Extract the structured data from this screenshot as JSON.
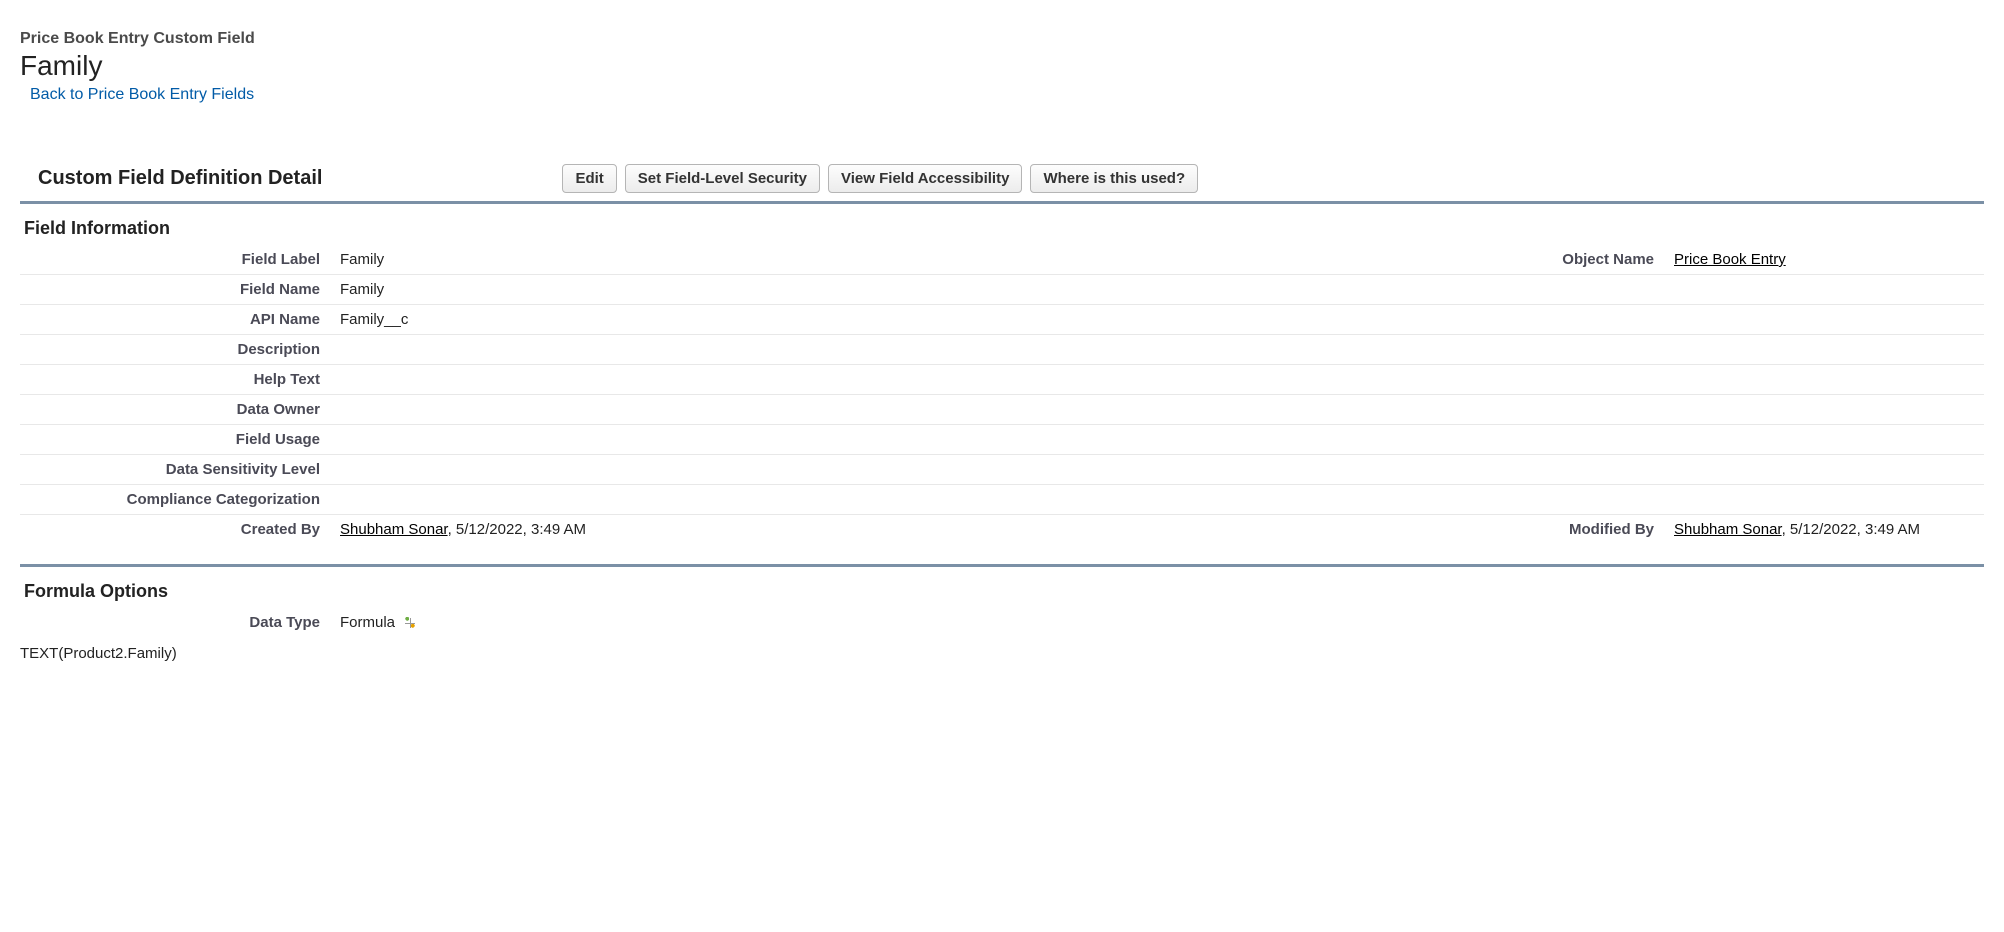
{
  "header": {
    "subtitle": "Price Book Entry Custom Field",
    "title": "Family",
    "back_link": "Back to Price Book Entry Fields"
  },
  "detail": {
    "section_title": "Custom Field Definition Detail",
    "buttons": {
      "edit": "Edit",
      "set_fls": "Set Field-Level Security",
      "view_fa": "View Field Accessibility",
      "where_used": "Where is this used?"
    }
  },
  "field_info": {
    "section_label": "Field Information",
    "labels": {
      "field_label": "Field Label",
      "object_name": "Object Name",
      "field_name": "Field Name",
      "api_name": "API Name",
      "description": "Description",
      "help_text": "Help Text",
      "data_owner": "Data Owner",
      "field_usage": "Field Usage",
      "data_sensitivity": "Data Sensitivity Level",
      "compliance": "Compliance Categorization",
      "created_by": "Created By",
      "modified_by": "Modified By"
    },
    "values": {
      "field_label": "Family",
      "object_name": "Price Book Entry",
      "field_name": "Family",
      "api_name": "Family__c",
      "description": "",
      "help_text": "",
      "data_owner": "",
      "field_usage": "",
      "data_sensitivity": "",
      "compliance": "",
      "created_by_name": "Shubham Sonar",
      "created_by_date": ", 5/12/2022, 3:49 AM",
      "modified_by_name": "Shubham Sonar",
      "modified_by_date": ", 5/12/2022, 3:49 AM"
    }
  },
  "formula": {
    "section_label": "Formula Options",
    "labels": {
      "data_type": "Data Type"
    },
    "values": {
      "data_type": "Formula",
      "formula_text": "TEXT(Product2.Family)"
    }
  }
}
